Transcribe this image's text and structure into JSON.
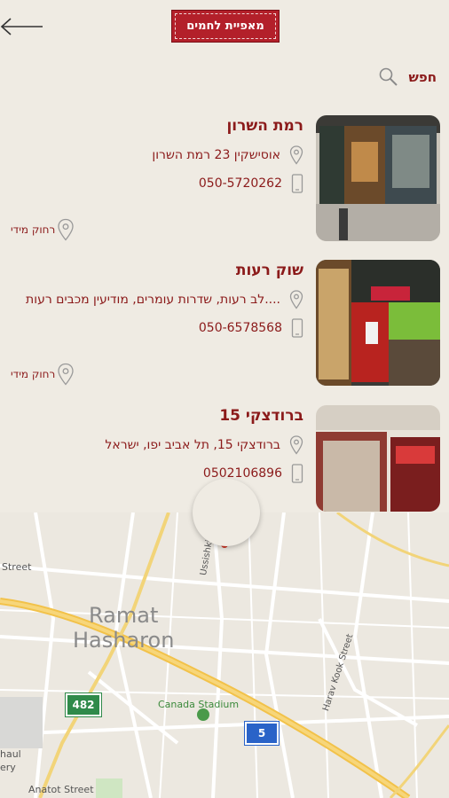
{
  "header": {
    "logo_text": "מאפיית לחמים",
    "back_icon": "arrow-left-icon"
  },
  "search": {
    "label": "חפש",
    "icon": "search-icon"
  },
  "stores": [
    {
      "name": "רמת השרון",
      "address": "אוסישקין 23 רמת השרון",
      "phone": "050-5720262",
      "distance": "רחוק מידי"
    },
    {
      "name": "שוק רעות",
      "address": "לב רעות, שדרות עומרים, מודיעין מכבים רעות....",
      "phone": "050-6578568",
      "distance": "רחוק מידי"
    },
    {
      "name": "ברודצקי 15",
      "address": "ברודצקי 15, תל אביב יפו, ישראל",
      "phone": "0502106896"
    }
  ],
  "map": {
    "city_line1": "Ramat",
    "city_line2": "Hasharon",
    "street_1": "Street",
    "street_2": "Ussishkin St",
    "street_3": "Harav Kook Street",
    "street_4": "Anatot Street",
    "poi": "Canada Stadium",
    "road_482": "482",
    "road_5": "5",
    "edge_1": "haul",
    "edge_2": "ery"
  },
  "colors": {
    "accent": "#8b1a1a",
    "brand": "#b3202a",
    "background": "#efebe3"
  }
}
